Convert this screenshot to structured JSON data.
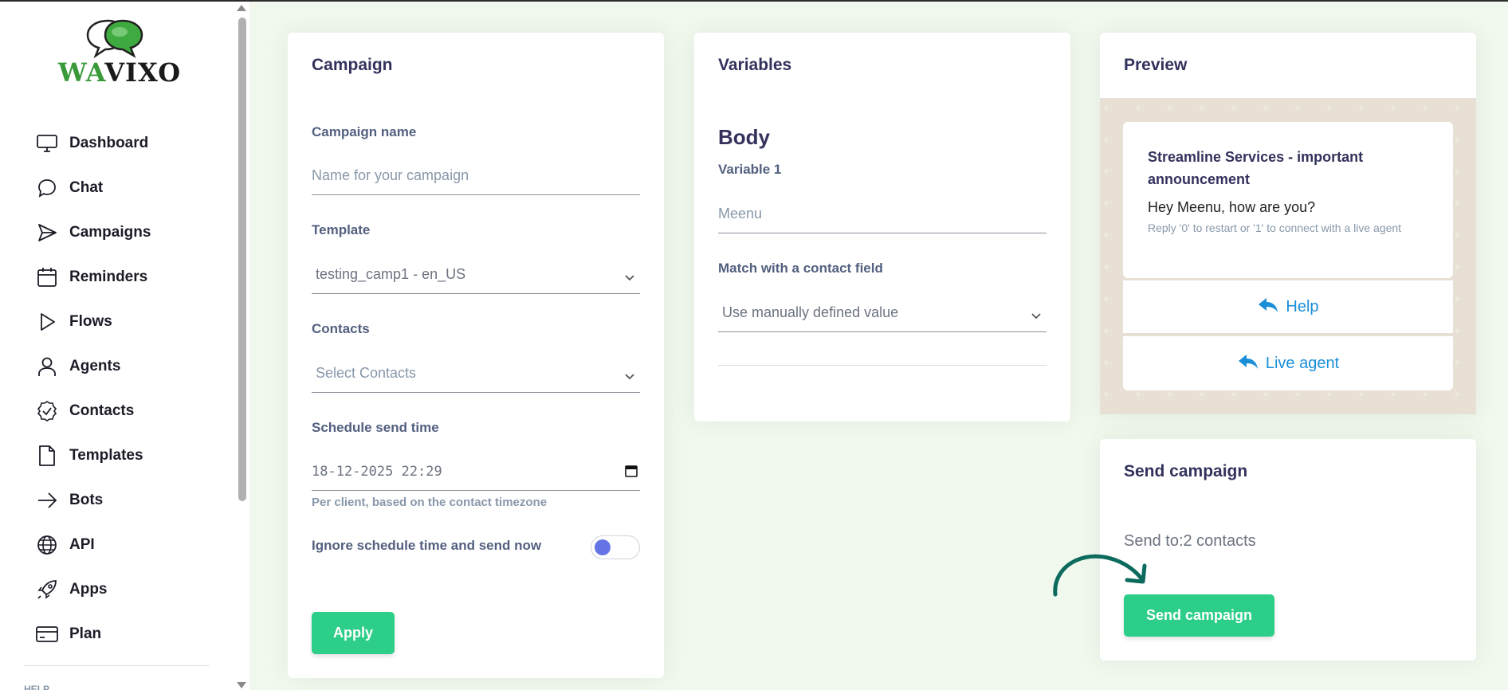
{
  "brand": {
    "logo_wa": "WA",
    "logo_vixo": "VIXO"
  },
  "sidebar": {
    "items": [
      {
        "label": "Dashboard",
        "icon": "monitor-icon"
      },
      {
        "label": "Chat",
        "icon": "chat-bubble-icon"
      },
      {
        "label": "Campaigns",
        "icon": "send-icon"
      },
      {
        "label": "Reminders",
        "icon": "calendar-icon"
      },
      {
        "label": "Flows",
        "icon": "play-icon"
      },
      {
        "label": "Agents",
        "icon": "user-icon"
      },
      {
        "label": "Contacts",
        "icon": "check-badge-icon"
      },
      {
        "label": "Templates",
        "icon": "file-icon"
      },
      {
        "label": "Bots",
        "icon": "arrow-right-icon"
      },
      {
        "label": "API",
        "icon": "globe-icon"
      },
      {
        "label": "Apps",
        "icon": "rocket-icon"
      },
      {
        "label": "Plan",
        "icon": "credit-card-icon"
      }
    ],
    "help_label": "HELP"
  },
  "campaign": {
    "title": "Campaign",
    "name_label": "Campaign name",
    "name_placeholder": "Name for your campaign",
    "template_label": "Template",
    "template_value": "testing_camp1 - en_US",
    "contacts_label": "Contacts",
    "contacts_placeholder": "Select Contacts",
    "schedule_label": "Schedule send time",
    "schedule_value": "18-12-2025 22:29",
    "schedule_hint": "Per client, based on the contact timezone",
    "ignore_label": "Ignore schedule time and send now",
    "apply_label": "Apply"
  },
  "variables": {
    "title": "Variables",
    "section": "Body",
    "var1_label": "Variable 1",
    "var1_value": "Meenu",
    "match_label": "Match with a contact field",
    "match_value": "Use manually defined value"
  },
  "preview": {
    "title": "Preview",
    "header": "Streamline Services - important announcement",
    "body": "Hey Meenu, how are you?",
    "footer": "Reply '0' to restart or '1' to connect with a live agent",
    "buttons": [
      "Help",
      "Live agent"
    ]
  },
  "send": {
    "title": "Send campaign",
    "send_to": "Send to:2 contacts",
    "button_label": "Send campaign"
  },
  "colors": {
    "accent_green": "#2dce89",
    "link_blue": "#1a8fd8",
    "arrow_teal": "#0d6b5e",
    "toggle_knob": "#6474e5"
  }
}
